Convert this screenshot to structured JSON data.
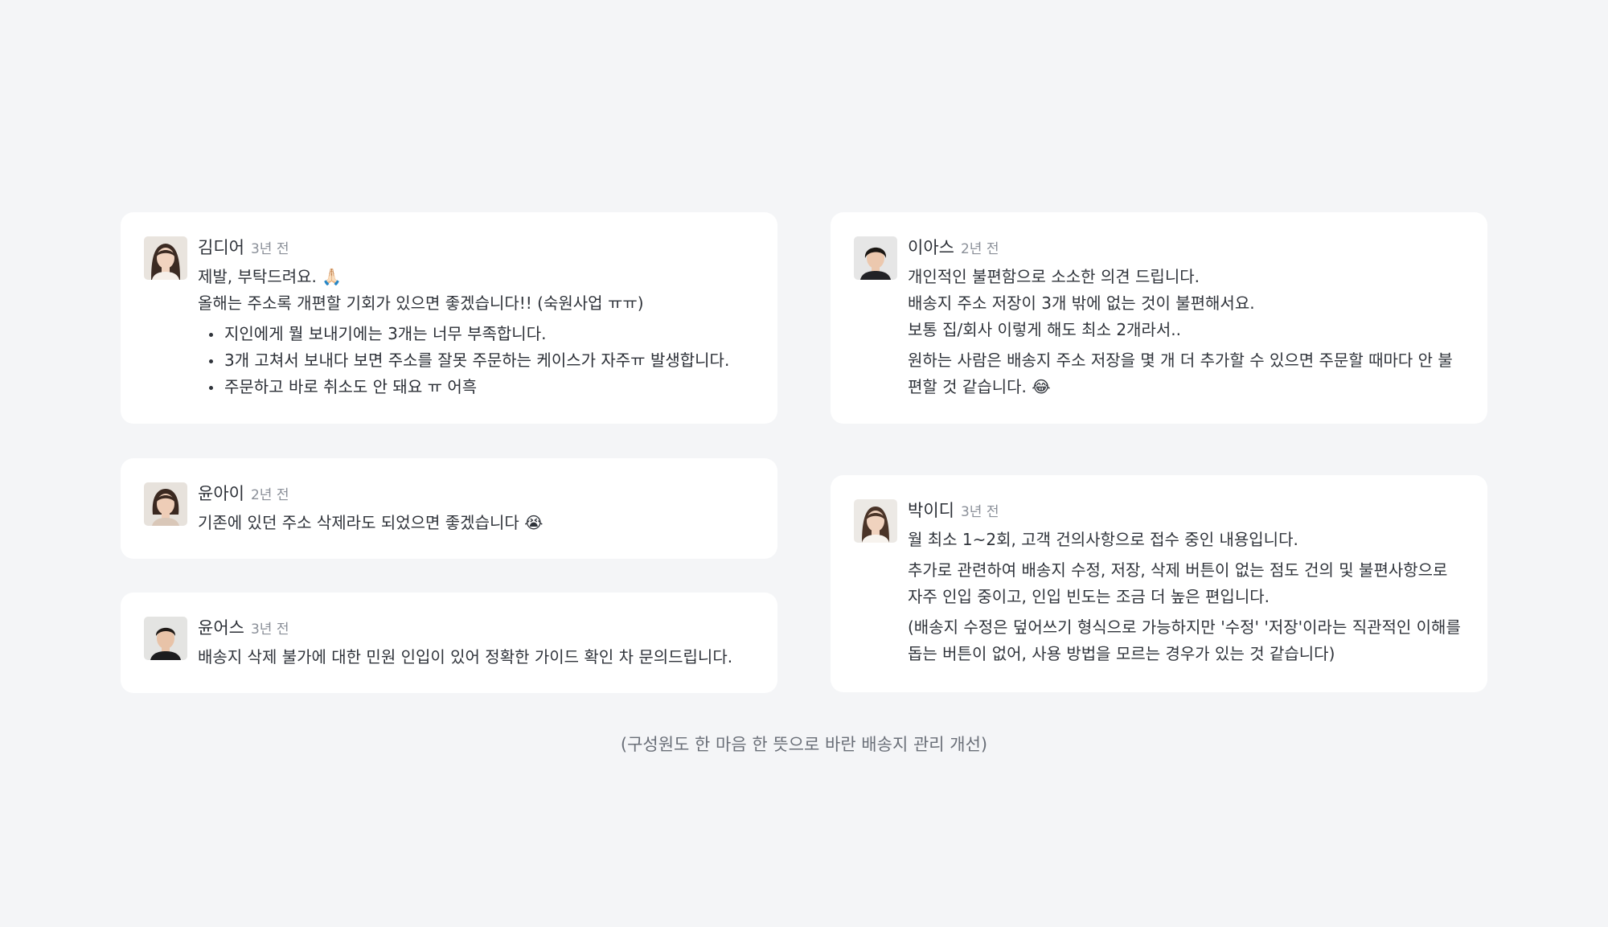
{
  "comments": [
    {
      "name": "김디어",
      "time": "3년 전",
      "lines": [
        "제발, 부탁드려요. 🙏🏻",
        "올해는 주소록 개편할 기회가 있으면 좋겠습니다!! (숙원사업 ㅠㅠ)"
      ],
      "bullets": [
        "지인에게 뭘 보내기에는 3개는 너무 부족합니다.",
        "3개 고쳐서 보내다 보면 주소를 잘못 주문하는 케이스가 자주ㅠ 발생합니다.",
        "주문하고 바로 취소도 안 돼요 ㅠ 어흑"
      ]
    },
    {
      "name": "윤아이",
      "time": "2년 전",
      "lines": [
        "기존에 있던 주소 삭제라도 되었으면 좋겠습니다 😭"
      ]
    },
    {
      "name": "윤어스",
      "time": "3년 전",
      "lines": [
        "배송지 삭제 불가에 대한 민원 인입이 있어 정확한 가이드 확인 차 문의드립니다."
      ]
    },
    {
      "name": "이아스",
      "time": "2년 전",
      "lines": [
        "개인적인 불편함으로 소소한 의견 드립니다.",
        "배송지 주소 저장이 3개 밖에 없는 것이 불편해서요.",
        "보통 집/회사 이렇게 해도 최소 2개라서.."
      ],
      "para": "원하는 사람은 배송지 주소 저장을 몇 개 더 추가할 수 있으면 주문할 때마다 안 불편할 것 같습니다. 😂"
    },
    {
      "name": "박이디",
      "time": "3년 전",
      "lines": [
        "월 최소 1~2회, 고객 건의사항으로 접수 중인 내용입니다."
      ],
      "paras": [
        "추가로 관련하여 배송지 수정, 저장, 삭제 버튼이 없는 점도 건의 및 불편사항으로 자주 인입 중이고, 인입 빈도는 조금 더 높은 편입니다.",
        "(배송지 수정은 덮어쓰기 형식으로 가능하지만 '수정' '저장'이라는 직관적인 이해를 돕는 버튼이 없어, 사용 방법을 모르는 경우가 있는 것 같습니다)"
      ]
    }
  ],
  "caption": "(구성원도 한 마음 한 뜻으로 바란 배송지 관리 개선)"
}
